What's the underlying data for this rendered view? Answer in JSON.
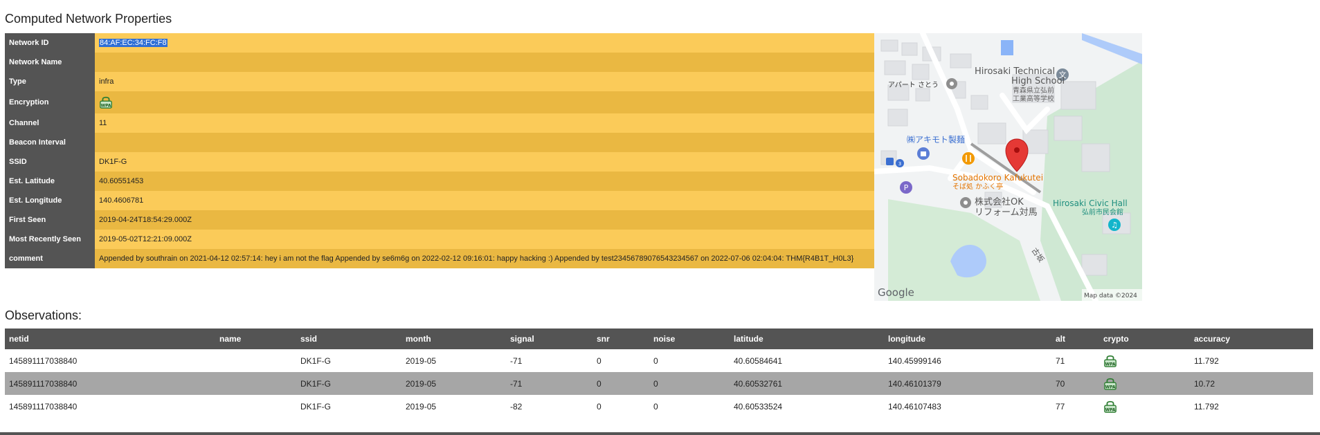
{
  "props_title": "Computed Network Properties",
  "observations_title": "Observations:",
  "properties": [
    {
      "label": "Network ID",
      "value": "84:AF:EC:34:FC:F8",
      "selected": true
    },
    {
      "label": "Network Name",
      "value": ""
    },
    {
      "label": "Type",
      "value": "infra"
    },
    {
      "label": "Encryption",
      "value": "",
      "icon": "wpa-lock-icon"
    },
    {
      "label": "Channel",
      "value": "11"
    },
    {
      "label": "Beacon Interval",
      "value": ""
    },
    {
      "label": "SSID",
      "value": "DK1F-G"
    },
    {
      "label": "Est. Latitude",
      "value": "40.60551453"
    },
    {
      "label": "Est. Longitude",
      "value": "140.4606781"
    },
    {
      "label": "First Seen",
      "value": "2019-04-24T18:54:29.000Z"
    },
    {
      "label": "Most Recently Seen",
      "value": "2019-05-02T12:21:09.000Z"
    },
    {
      "label": "comment",
      "value": "Appended by southrain on 2021-04-12 02:57:14: hey i am not the flag Appended by se6m6g on 2022-02-12 09:16:01: happy hacking :) Appended by test234567890765432345​67 on 2022-07-06 02:04:04: THM{R4B1T_H0L3}"
    }
  ],
  "map": {
    "labels": {
      "apart": "アパート さとう",
      "school_en_1": "Hirosaki Technical",
      "school_en_2": "High School",
      "school_jp_1": "青森県立弘前",
      "school_jp_2": "工業高等学校",
      "akimoto": "㈱アキモト製麺",
      "soba_en": "Sobadokoro Kafukutei",
      "soba_jp": "そば処 かふく亭",
      "ok_1": "株式会社OK",
      "ok_2": "リフォーム対馬",
      "civic_en": "Hirosaki Civic Hall",
      "civic_jp": "弘前市民会館",
      "road": "古坂",
      "google": "Google",
      "attribution": "Map data ©2024"
    },
    "colors": {
      "pin": "#e53935",
      "park": "#c8e6c9",
      "water": "#aecbfa"
    }
  },
  "observations": {
    "columns": [
      "netid",
      "name",
      "ssid",
      "month",
      "signal",
      "snr",
      "noise",
      "latitude",
      "longitude",
      "alt",
      "crypto",
      "accuracy"
    ],
    "rows": [
      {
        "netid": "145891117038840",
        "name": "",
        "ssid": "DK1F-G",
        "month": "2019-05",
        "signal": "-71",
        "snr": "0",
        "noise": "0",
        "latitude": "40.60584641",
        "longitude": "140.45999146",
        "alt": "71",
        "crypto": "wpa-lock-icon",
        "accuracy": "11.792"
      },
      {
        "netid": "145891117038840",
        "name": "",
        "ssid": "DK1F-G",
        "month": "2019-05",
        "signal": "-71",
        "snr": "0",
        "noise": "0",
        "latitude": "40.60532761",
        "longitude": "140.46101379",
        "alt": "70",
        "crypto": "wpa-lock-icon",
        "accuracy": "10.72"
      },
      {
        "netid": "145891117038840",
        "name": "",
        "ssid": "DK1F-G",
        "month": "2019-05",
        "signal": "-82",
        "snr": "0",
        "noise": "0",
        "latitude": "40.60533524",
        "longitude": "140.46107483",
        "alt": "77",
        "crypto": "wpa-lock-icon",
        "accuracy": "11.792"
      }
    ]
  }
}
